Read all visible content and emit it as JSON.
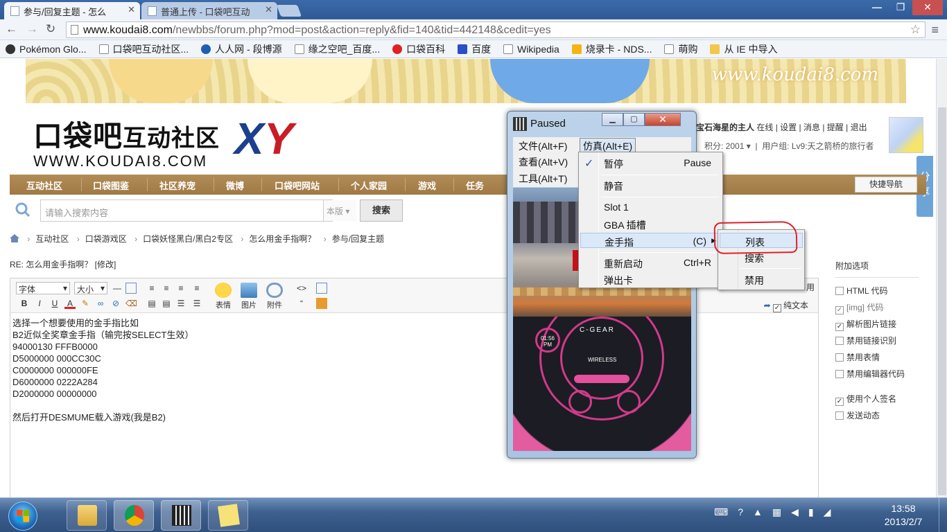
{
  "browser": {
    "tabs": [
      {
        "title": "参与/回复主题 - 怎么",
        "active": true
      },
      {
        "title": "普通上传 - 口袋吧互动",
        "active": false
      }
    ],
    "url_host": "www.koudai8.com",
    "url_path": "/newbbs/forum.php?mod=post&action=reply&fid=140&tid=442148&cedit=yes",
    "bookmarks": [
      "Pokémon Glo...",
      "口袋吧互动社区...",
      "人人网 - 段博源",
      "缘之空吧_百度...",
      "口袋百科",
      "百度",
      "Wikipedia",
      "烧录卡 - NDS...",
      "萌购",
      "从 IE 中导入"
    ]
  },
  "site": {
    "banner_text": "www.koudai8.com",
    "logo_main": "口袋吧",
    "logo_sub": "互动社区",
    "logo_xy1": "X",
    "logo_xy2": "Y",
    "logo_url": "WWW.KOUDAI8.COM",
    "user": {
      "name": "宝石海星的主人",
      "status": "在线",
      "links": [
        "设置",
        "消息",
        "提醒",
        "退出"
      ],
      "points_label": "积分: 2001",
      "group_label": "用户组: Lv9:天之箭桥的旅行者"
    },
    "share_label": "分享",
    "nav": [
      "互动社区",
      "口袋图鉴",
      "社区养宠",
      "微博",
      "口袋吧网站",
      "个人家园",
      "游戏",
      "任务"
    ],
    "quick_nav": "快捷导航",
    "search_placeholder": "请输入搜索内容",
    "search_scope": "本版",
    "search_button": "搜索",
    "breadcrumb": [
      "互动社区",
      "口袋游戏区",
      "口袋妖怪黑白/黑白2专区",
      "怎么用金手指啊？",
      "参与/回复主题"
    ],
    "reply_title": "RE: 怎么用金手指啊？ [修改]"
  },
  "editor": {
    "font_select": "字体",
    "size_select": "大小",
    "emoji_label": "表情",
    "image_label": "图片",
    "attach_label": "附件",
    "cut_label": "用",
    "plain_text_label": "纯文本",
    "lines": [
      "选择一个想要使用的金手指比如",
      "B2近似全奖章金手指（输完按SELECT生效）",
      "94000130 FFFB0000",
      "D5000000 000CC30C",
      "C0000000 000000FE",
      "D6000000 0222A284",
      "D2000000 00000000",
      "",
      "然后打开DESMUME载入游戏(我是B2)"
    ]
  },
  "options": {
    "title": "附加选项",
    "items": [
      {
        "label": "HTML 代码",
        "checked": false,
        "dim": false
      },
      {
        "label": "[img] 代码",
        "checked": true,
        "dim": true
      },
      {
        "label": "解析图片链接",
        "checked": true,
        "dim": false
      },
      {
        "label": "禁用链接识别",
        "checked": false,
        "dim": false
      },
      {
        "label": "禁用表情",
        "checked": false,
        "dim": false
      },
      {
        "label": "禁用编辑器代码",
        "checked": false,
        "dim": false
      },
      {
        "label": "使用个人签名",
        "checked": true,
        "dim": false
      },
      {
        "label": "发送动态",
        "checked": false,
        "dim": false
      }
    ]
  },
  "emulator": {
    "title": "Paused",
    "menubar": [
      "文件(Alt+F)",
      "仿真(Alt+E)",
      "查看(Alt+V)",
      "工具(Alt+T)"
    ],
    "emu_menu": {
      "pause": "暂停",
      "pause_acc": "Pause",
      "mute": "静音",
      "slot1": "Slot 1",
      "gba": "GBA 插槽",
      "cheats": "金手指",
      "cheats_acc": "(C)",
      "restart": "重新启动",
      "restart_acc": "Ctrl+R",
      "eject": "弹出卡"
    },
    "cheat_submenu": [
      "列表",
      "搜索",
      "禁用"
    ],
    "screen_gear": "C-GEAR",
    "screen_wireless": "WIRELESS",
    "screen_time": "01:56 PM"
  },
  "taskbar": {
    "time": "13:58",
    "date": "2013/2/7"
  },
  "colors": {
    "nav_bg": "#a98349",
    "chrome_tab_bg": "#3c6aa8",
    "menu_highlight": "#dbe8f8",
    "annotation_red": "#e0202a"
  }
}
